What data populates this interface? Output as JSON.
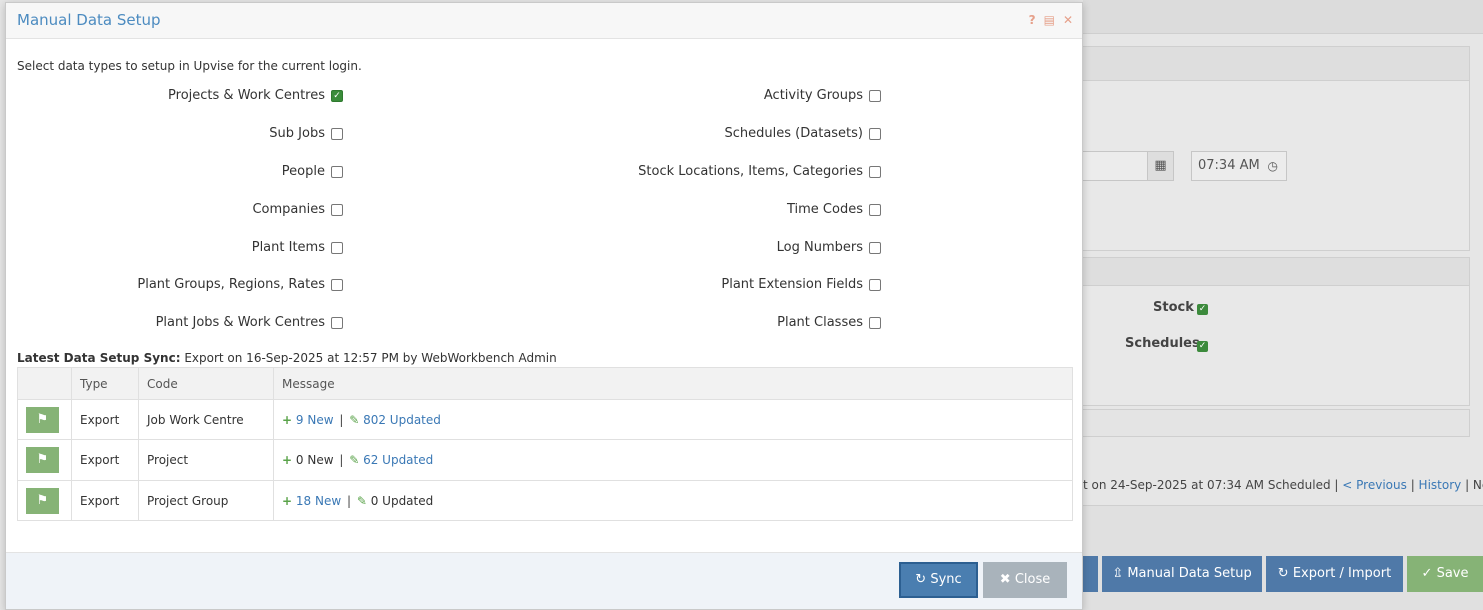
{
  "background": {
    "time_value": "07:34 AM",
    "checks": [
      {
        "label": "Stock",
        "checked": true
      },
      {
        "label": "Schedules",
        "checked": true
      }
    ],
    "schedule_text": "t on 24-Sep-2025 at 07:34 AM Scheduled |",
    "previous_link": "< Previous",
    "history_link": "History",
    "next_link": "Next >",
    "buttons": {
      "manual_data_setup": "Manual Data Setup",
      "export_import": "Export / Import",
      "save": "Save"
    }
  },
  "modal": {
    "title": "Manual Data Setup",
    "header_icons": [
      "help-icon",
      "table-icon",
      "close-icon"
    ],
    "intro": "Select data types to setup in Upvise for the current login.",
    "left_options": [
      {
        "label": "Projects & Work Centres",
        "checked": true
      },
      {
        "label": "Sub Jobs",
        "checked": false
      },
      {
        "label": "People",
        "checked": false
      },
      {
        "label": "Companies",
        "checked": false
      },
      {
        "label": "Plant Items",
        "checked": false
      },
      {
        "label": "Plant Groups, Regions, Rates",
        "checked": false
      },
      {
        "label": "Plant Jobs & Work Centres",
        "checked": false
      }
    ],
    "right_options": [
      {
        "label": "Activity Groups",
        "checked": false
      },
      {
        "label": "Schedules (Datasets)",
        "checked": false
      },
      {
        "label": "Stock Locations, Items, Categories",
        "checked": false
      },
      {
        "label": "Time Codes",
        "checked": false
      },
      {
        "label": "Log Numbers",
        "checked": false
      },
      {
        "label": "Plant Extension Fields",
        "checked": false
      },
      {
        "label": "Plant Classes",
        "checked": false
      }
    ],
    "latest_label": "Latest Data Setup Sync:",
    "latest_value": "Export on 16-Sep-2025 at 12:57 PM by WebWorkbench Admin",
    "table": {
      "headers": [
        "",
        "Type",
        "Code",
        "Message"
      ],
      "rows": [
        {
          "type": "Export",
          "code": "Job Work Centre",
          "new_text": "9 New",
          "new_link": true,
          "updated_text": "802 Updated",
          "updated_link": true
        },
        {
          "type": "Export",
          "code": "Project",
          "new_text": "0 New",
          "new_link": false,
          "updated_text": "62 Updated",
          "updated_link": true
        },
        {
          "type": "Export",
          "code": "Project Group",
          "new_text": "18 New",
          "new_link": true,
          "updated_text": "0 Updated",
          "updated_link": false
        }
      ]
    },
    "footer": {
      "sync_label": "Sync",
      "close_label": "Close"
    }
  }
}
